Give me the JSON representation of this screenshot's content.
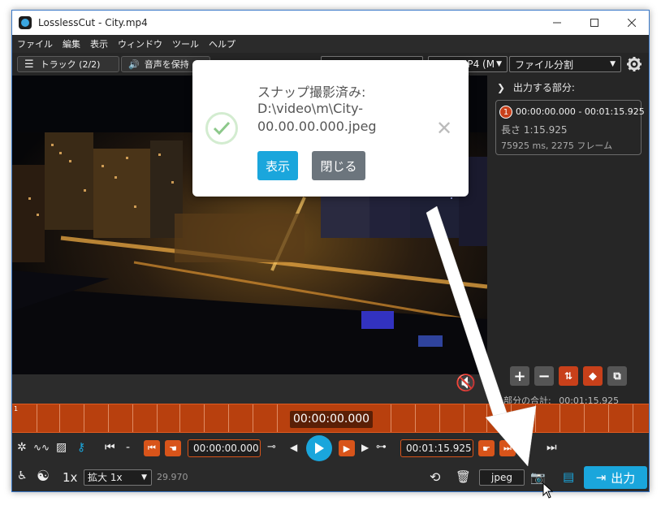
{
  "window": {
    "title": "LosslessCut - City.mp4"
  },
  "menu": [
    "ファイル",
    "編集",
    "表示",
    "ウィンドウ",
    "ツール",
    "ヘルプ"
  ],
  "toolbar": {
    "tracks_label": "トラック (2/2)",
    "audio_label": "音声を保持",
    "format_value": "MP4 (M",
    "mode_value": "ファイル分割"
  },
  "toast": {
    "title": "スナップ撮影済み:",
    "path_line1": "D:\\video\\m\\City-",
    "path_line2": "00.00.00.000.jpeg",
    "show_button": "表示",
    "close_button": "閉じる"
  },
  "sidebar": {
    "title": "出力する部分:",
    "segment": {
      "number": "1",
      "range": "00:00:00.000 - 00:01:15.925",
      "length": "長さ 1:15.925",
      "frames": "75925 ms, 2275 フレーム"
    },
    "total_label": "部分の合計:",
    "total_value": "00:01:15.925"
  },
  "timeline": {
    "current_time": "00:00:00.000",
    "marker": "1"
  },
  "controls": {
    "minus": "-",
    "start_time": "00:00:00.000",
    "end_time": "00:01:15.925"
  },
  "bottom": {
    "speed": "1x",
    "zoom_value": "拡大 1x",
    "fps": "29.970",
    "capture_format": "jpeg",
    "export_label": "出力"
  },
  "colors": {
    "accent": "#1aa6dc",
    "timeline": "#b8400e",
    "segment_marker": "#d8541a",
    "toast_button_show": "#1aa6dc",
    "toast_button_close": "#6c757d"
  }
}
